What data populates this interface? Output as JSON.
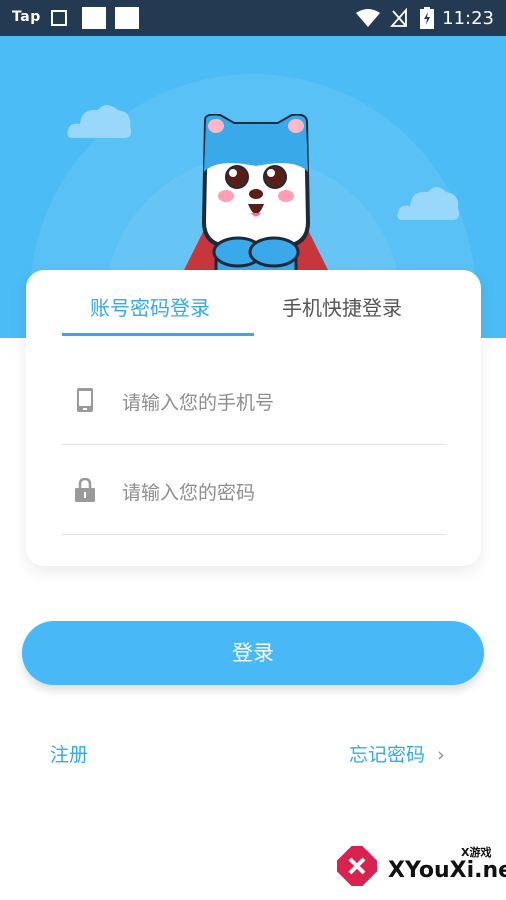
{
  "status_bar": {
    "carrier_label": "Tap",
    "time": "11:23"
  },
  "login_tabs": [
    {
      "label": "账号密码登录",
      "active": true
    },
    {
      "label": "手机快捷登录",
      "active": false
    }
  ],
  "form": {
    "phone_placeholder": "请输入您的手机号",
    "password_placeholder": "请输入您的密码"
  },
  "login_button_label": "登录",
  "links": {
    "register": "注册",
    "forgot_password": "忘记密码",
    "forgot_arrow": "›"
  },
  "watermark": {
    "brand": "XYouXi.net",
    "tag": "X游戏"
  },
  "colors": {
    "primary": "#4bbcf5",
    "accent_text": "#35a8ee",
    "status_bar": "#243a52"
  },
  "icons": [
    "image-icon",
    "wifi-icon",
    "signal-icon",
    "battery-icon",
    "phone-icon",
    "lock-icon",
    "chevron-right-icon",
    "mascot-illustration",
    "cloud-decoration"
  ]
}
